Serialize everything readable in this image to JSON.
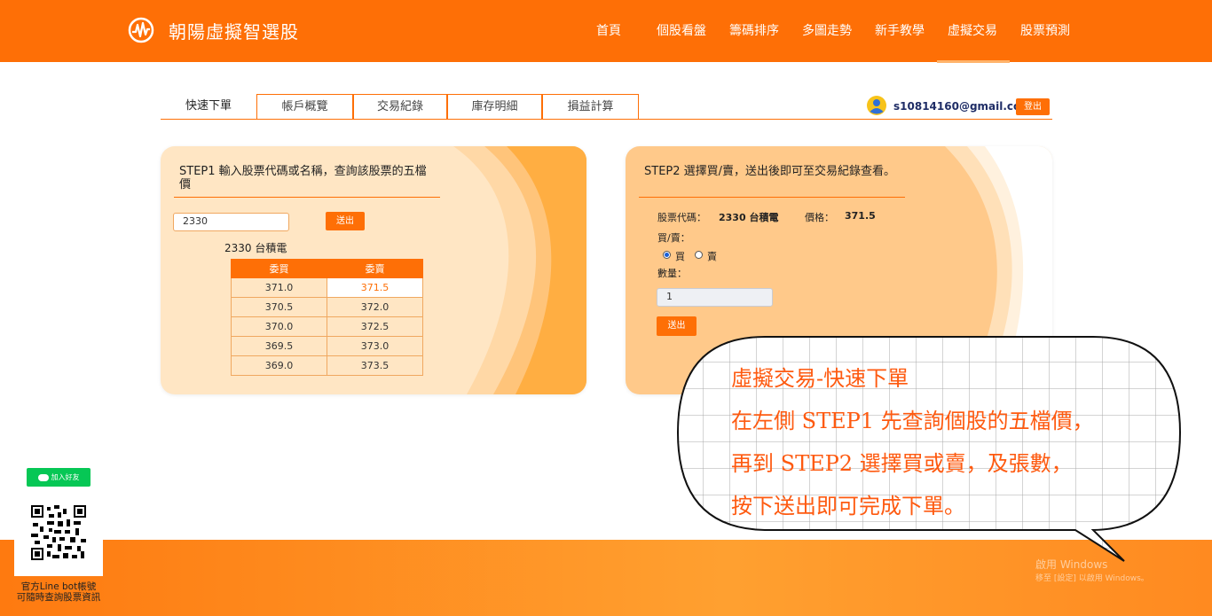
{
  "header": {
    "brand": "朝陽虛擬智選股",
    "nav": [
      {
        "label": "首頁",
        "icon": "home-nav"
      },
      {
        "label": "個股看盤"
      },
      {
        "label": "籌碼排序"
      },
      {
        "label": "多圖走勢"
      },
      {
        "label": "新手教學"
      },
      {
        "label": "虛擬交易",
        "active": true
      },
      {
        "label": "股票預測"
      }
    ],
    "accent": "#fe6f06"
  },
  "tabs": [
    "快速下單",
    "帳戶概覽",
    "交易紀錄",
    "庫存明細",
    "損益計算"
  ],
  "user": {
    "email": "s10814160@gmail.com",
    "logout": "登出"
  },
  "step1": {
    "title": "STEP1 輸入股票代碼或名稱，查詢該股票的五檔價",
    "input_value": "2330",
    "submit": "送出",
    "stock_name": "2330 台積電",
    "headers": [
      "委買",
      "委賣"
    ],
    "rows": [
      [
        "371.0",
        "371.5"
      ],
      [
        "370.5",
        "372.0"
      ],
      [
        "370.0",
        "372.5"
      ],
      [
        "369.5",
        "373.0"
      ],
      [
        "369.0",
        "373.5"
      ]
    ]
  },
  "step2": {
    "title": "STEP2 選擇買/賣，送出後即可至交易紀錄查看。",
    "code_label": "股票代碼：",
    "code_value": "2330 台積電",
    "price_label": "價格：",
    "price_value": "371.5",
    "side_label": "買/賣：",
    "buy": "買",
    "sell": "賣",
    "side_selected": "買",
    "qty_label": "數量：",
    "qty_value": "1",
    "submit": "送出"
  },
  "bubble": {
    "lines": [
      "虛擬交易-快速下單",
      "在左側 STEP1 先查詢個股的五檔價，",
      "再到 STEP2 選擇買或賣，及張數，",
      "按下送出即可完成下單。"
    ]
  },
  "sidebar": {
    "line_button": "加入好友",
    "caption_1": "官方Line bot帳號",
    "caption_2": "可隨時查詢股票資訊"
  },
  "watermark": {
    "line1": "啟用 Windows",
    "line2": "移至 [設定] 以啟用 Windows。"
  }
}
